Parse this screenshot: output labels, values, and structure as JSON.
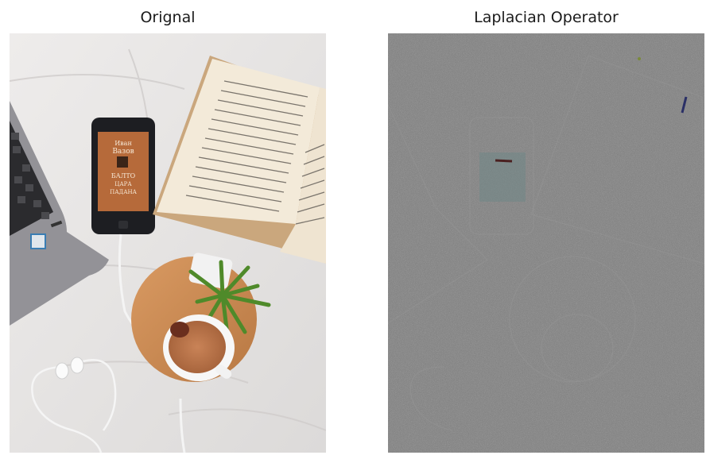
{
  "panels": [
    {
      "title": "Orignal"
    },
    {
      "title": "Laplacian Operator"
    }
  ],
  "photo": {
    "book_cover_lines": [
      "Иван",
      "Вазов",
      "БАЛТО",
      "ЦАРА",
      "ПАДАНА"
    ]
  },
  "colors": {
    "sheet": "#e6e4e3",
    "laptop": "#8f8e93",
    "tray": "#c98a55",
    "coffee": "#b8734a",
    "plant": "#4f8a2a",
    "laplacian_bg": "#7c7c7c"
  }
}
